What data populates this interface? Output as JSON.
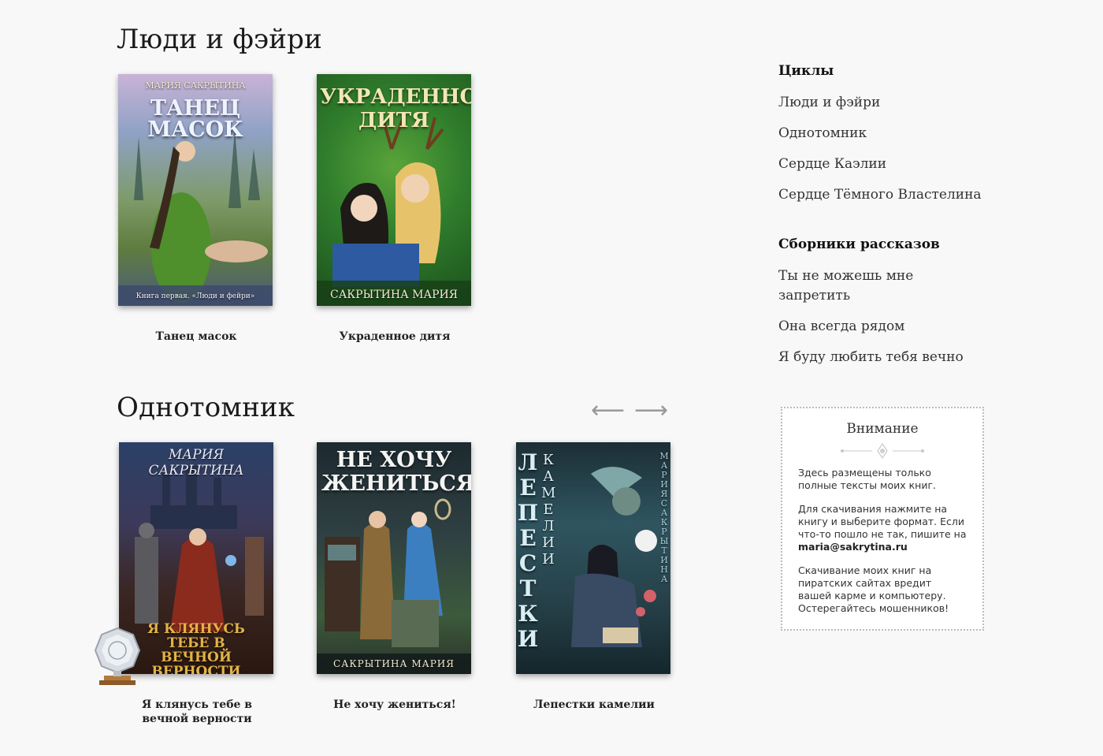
{
  "sections": [
    {
      "title": "Люди и фэйри",
      "books": [
        {
          "caption": "Танец масок",
          "cover": {
            "author": "МАРИЯ САКРЫТИНА",
            "title": "ТАНЕЦ МАСОК",
            "subtitle": "Книга первая. «Люди и фейри»",
            "bg": "#6c86b0"
          }
        },
        {
          "caption": "Украденное дитя",
          "cover": {
            "title": "УКРАДЕННОЕ ДИТЯ",
            "author": "САКРЫТИНА МАРИЯ",
            "bg": "#2f7d2c"
          }
        }
      ]
    },
    {
      "title": "Однотомник",
      "books": [
        {
          "caption": "Я клянусь тебе в вечной верности",
          "cover": {
            "author": "МАРИЯ САКРЫТИНА",
            "title": "Я КЛЯНУСЬ ТЕБЕ В ВЕЧНОЙ ВЕРНОСТИ",
            "bg": "#2a3550"
          }
        },
        {
          "caption": "Не хочу жениться!",
          "cover": {
            "title": "НЕ ХОЧУ ЖЕНИТЬСЯ",
            "author": "САКРЫТИНА МАРИЯ",
            "bg": "#2d3b3c"
          }
        },
        {
          "caption": "Лепестки камелии",
          "cover": {
            "title_vertical": "ЛЕПЕСТКИ",
            "subtitle_vertical": "КАМЕЛИИ",
            "author_vertical": "МАРИЯ САКРЫТИНА",
            "bg": "#24414a"
          }
        }
      ]
    }
  ],
  "carousel": {
    "prev_icon": "arrow-left-icon",
    "next_icon": "arrow-right-icon",
    "prev_glyph": "⟵",
    "next_glyph": "⟶"
  },
  "sidebar": {
    "cycles_heading": "Циклы",
    "cycles": [
      "Люди и фэйри",
      "Однотомник",
      "Сердце Каэлии",
      "Сердце Тёмного Властелина"
    ],
    "collections_heading": "Сборники рассказов",
    "collections": [
      "Ты не можешь мне запретить",
      "Она всегда рядом",
      "Я буду любить тебя вечно"
    ]
  },
  "notice": {
    "title": "Внимание",
    "para1": "Здесь размещены только полные тексты моих книг.",
    "para2": "Для скачивания нажмите на книгу и выберите формат. Если что-то пошло не так, пишите на",
    "email": "maria@sakrytina.ru",
    "para3": "Скачивание моих книг на пиратских сайтах вредит вашей карме и компьютеру. Остерегайтесь мошенников!"
  },
  "colors": {
    "background": "#f8f8f8",
    "text": "#222222",
    "arrow": "#999999",
    "notice_border": "#bbbbbb"
  }
}
